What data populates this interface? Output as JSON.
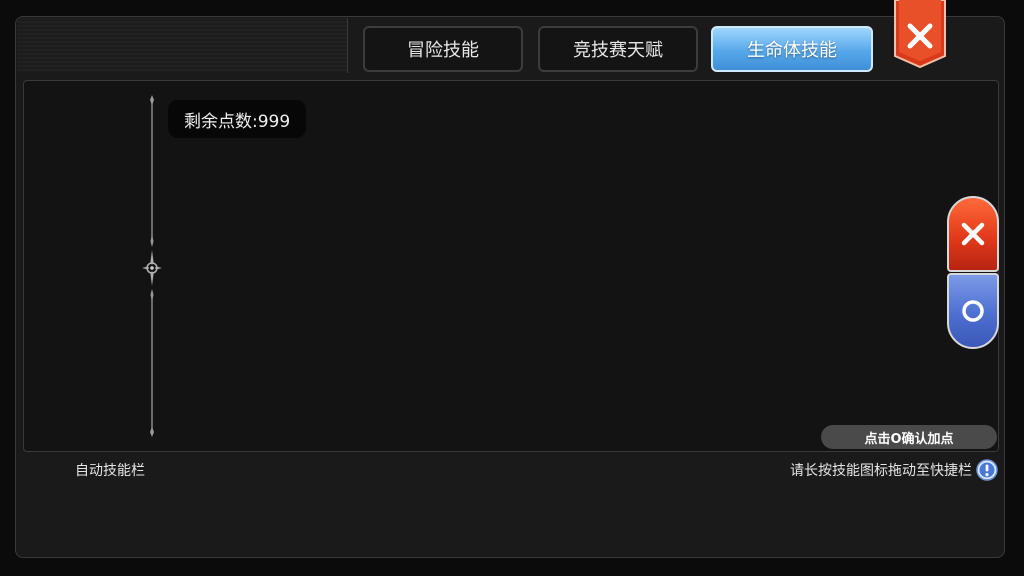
{
  "tabs": [
    {
      "label": "冒险技能",
      "active": false
    },
    {
      "label": "竞技赛天赋",
      "active": false
    },
    {
      "label": "生命体技能",
      "active": true
    }
  ],
  "points": {
    "text": "剩余点数:999"
  },
  "panel": {
    "confirm_hint": "点击O确认加点"
  },
  "footer": {
    "auto_skill_bar": "自动技能栏",
    "drag_hint": "请长按技能图标拖动至快捷栏"
  },
  "icons": {
    "close": "close-x-icon",
    "cancel": "x-icon",
    "confirm": "circle-icon",
    "info": "info-icon",
    "ornament": "compass-star-icon"
  },
  "colors": {
    "active_tab": "#57a8ea",
    "close_red": "#e23a1a",
    "confirm_blue": "#4d6fd0"
  }
}
